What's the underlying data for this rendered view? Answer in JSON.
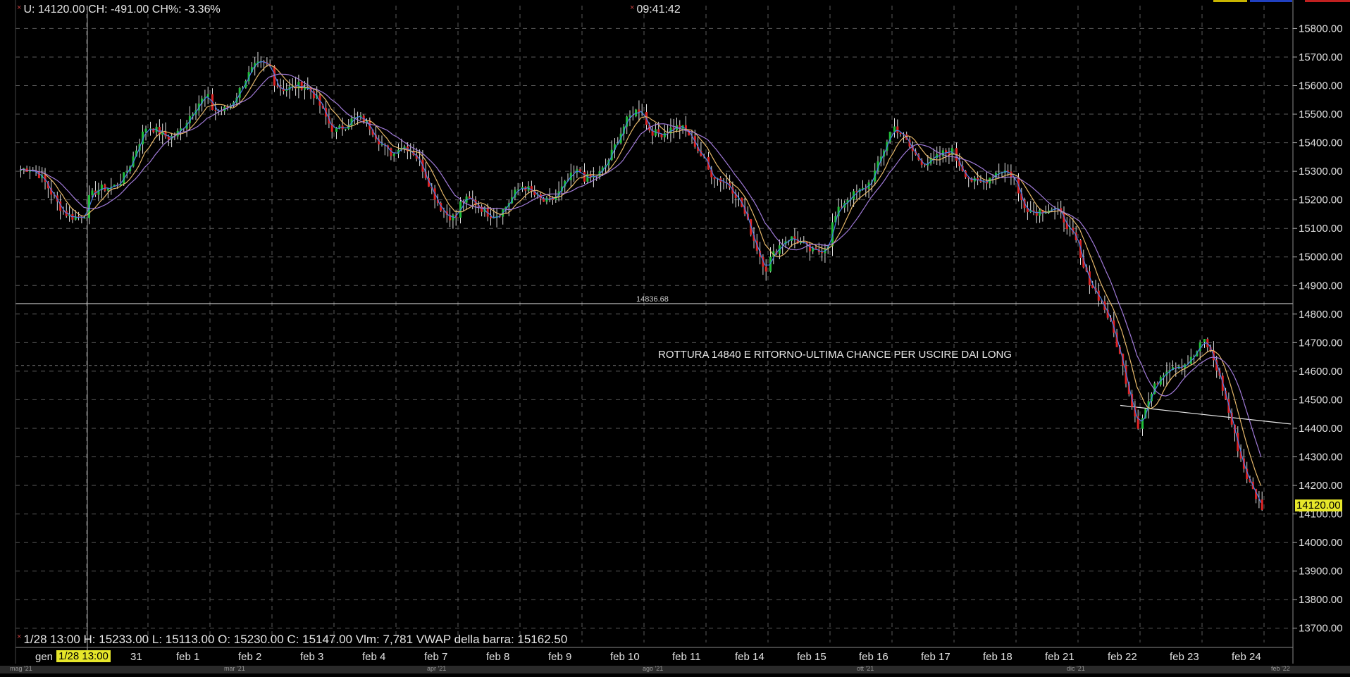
{
  "header": {
    "quote_line": "U: 14120.00 CH: -491.00 CH%: -3.36%",
    "clock": "09:41:42"
  },
  "status_bar": {
    "text": "1/28 13:00  H: 15233.00  L: 15113.00  O: 15230.00  C: 15147.00  Vlm: 7,781  VWAP della barra: 15162.50"
  },
  "cursor_badge": "1/28 13:00",
  "colors": {
    "background": "#000000",
    "up_candle": "#1fbf3a",
    "down_candle": "#e02424",
    "wick": "#e0e0e0",
    "ma_fast": "#4a7ee8",
    "ma_mid": "#e6b86a",
    "ma_slow": "#a07ad8",
    "grid": "#5a5a5a",
    "price_badge": "#e6e62a"
  },
  "bottom_strip_labels": [
    "mag '21",
    "mar '21",
    "apr '21",
    "ago '21",
    "ott '21",
    "dic '21",
    "feb '22"
  ],
  "chart_data": {
    "type": "candlestick",
    "title": "",
    "xlabel": "",
    "ylabel": "",
    "ylim": [
      13650,
      15880
    ],
    "y_ticks": [
      13700,
      13800,
      13900,
      14000,
      14100,
      14200,
      14300,
      14400,
      14500,
      14600,
      14700,
      14800,
      14900,
      15000,
      15100,
      15200,
      15300,
      15400,
      15500,
      15600,
      15700,
      15800
    ],
    "x_labels": [
      "gen",
      "31",
      "feb 1",
      "feb 2",
      "feb 3",
      "feb 4",
      "feb 7",
      "feb 8",
      "feb 9",
      "feb 10",
      "feb 11",
      "feb 14",
      "feb 15",
      "feb 16",
      "feb 17",
      "feb 18",
      "feb 21",
      "feb 22",
      "feb 23",
      "feb 24"
    ],
    "grid": true,
    "last_price": 14120.0,
    "last_price_label": "14120.00",
    "horizontal_level": {
      "value": 14836.68,
      "label": "14836.68"
    },
    "dashed_level": 14620,
    "annotation": "ROTTURA 14840 E RITORNO-ULTIMA CHANCE PER USCIRE DAI LONG",
    "trendline": {
      "from": {
        "day": "feb 22",
        "value": 14480
      },
      "to": {
        "day": "feb 24",
        "value": 14415
      }
    },
    "daily_closes": [
      {
        "day": "gen 28",
        "value": 15150
      },
      {
        "day": "31",
        "value": 15420
      },
      {
        "day": "feb 1",
        "value": 15520
      },
      {
        "day": "feb 2",
        "value": 15660
      },
      {
        "day": "feb 3",
        "value": 15480
      },
      {
        "day": "feb 4",
        "value": 15400
      },
      {
        "day": "feb 7",
        "value": 15150
      },
      {
        "day": "feb 8",
        "value": 15210
      },
      {
        "day": "feb 9",
        "value": 15260
      },
      {
        "day": "feb 10",
        "value": 15500
      },
      {
        "day": "feb 11",
        "value": 15360
      },
      {
        "day": "feb 14",
        "value": 15000
      },
      {
        "day": "feb 15",
        "value": 15070
      },
      {
        "day": "feb 16",
        "value": 15420
      },
      {
        "day": "feb 17",
        "value": 15330
      },
      {
        "day": "feb 18",
        "value": 15250
      },
      {
        "day": "feb 21",
        "value": 15060
      },
      {
        "day": "feb 22",
        "value": 14450
      },
      {
        "day": "feb 23",
        "value": 14720
      },
      {
        "day": "feb 24",
        "value": 14120
      }
    ]
  }
}
